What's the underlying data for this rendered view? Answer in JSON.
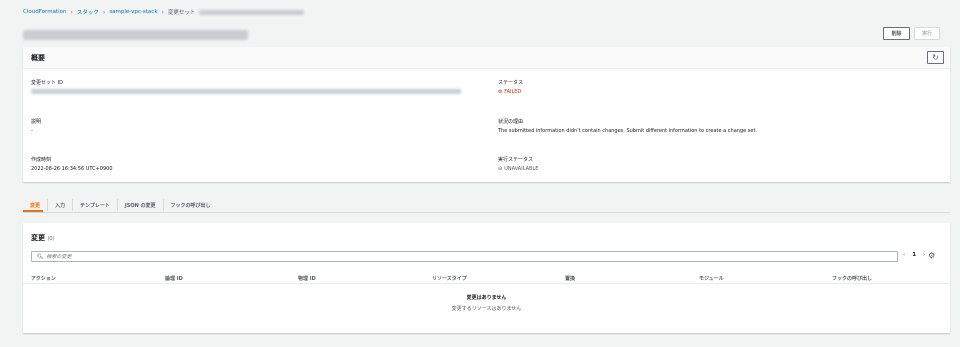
{
  "breadcrumb": {
    "items": [
      "CloudFormation",
      "スタック",
      "sample-vpc-stack",
      "変更セット"
    ],
    "separator": ">"
  },
  "header": {
    "delete_label": "削除",
    "execute_label": "実行"
  },
  "overview": {
    "title": "概要",
    "change_set_id_label": "変更セット ID",
    "description_label": "説明",
    "description_value": "-",
    "created_label": "作成時刻",
    "created_value": "2022-08-26 16:34:56 UTC+0900",
    "status_label": "ステータス",
    "status_value": "FAILED",
    "reason_label": "状況の理由",
    "reason_value": "The submitted information didn't contain changes. Submit different information to create a change set.",
    "exec_status_label": "実行ステータス",
    "exec_status_value": "UNAVAILABLE"
  },
  "tabs": [
    "変更",
    "入力",
    "テンプレート",
    "JSON の変更",
    "フックの呼び出し"
  ],
  "changes": {
    "title": "変更",
    "count": "(0)",
    "search_placeholder": "検索の変更",
    "page": "1",
    "columns": [
      "アクション",
      "論理 ID",
      "物理 ID",
      "リソースタイプ",
      "置換",
      "モジュール",
      "フックの呼び出し"
    ],
    "empty_title": "変更はありません",
    "empty_subtitle": "変更するリソースはありません"
  },
  "colors": {
    "link": "#0073bb",
    "active_tab": "#ec7211",
    "failed": "#d13212"
  }
}
